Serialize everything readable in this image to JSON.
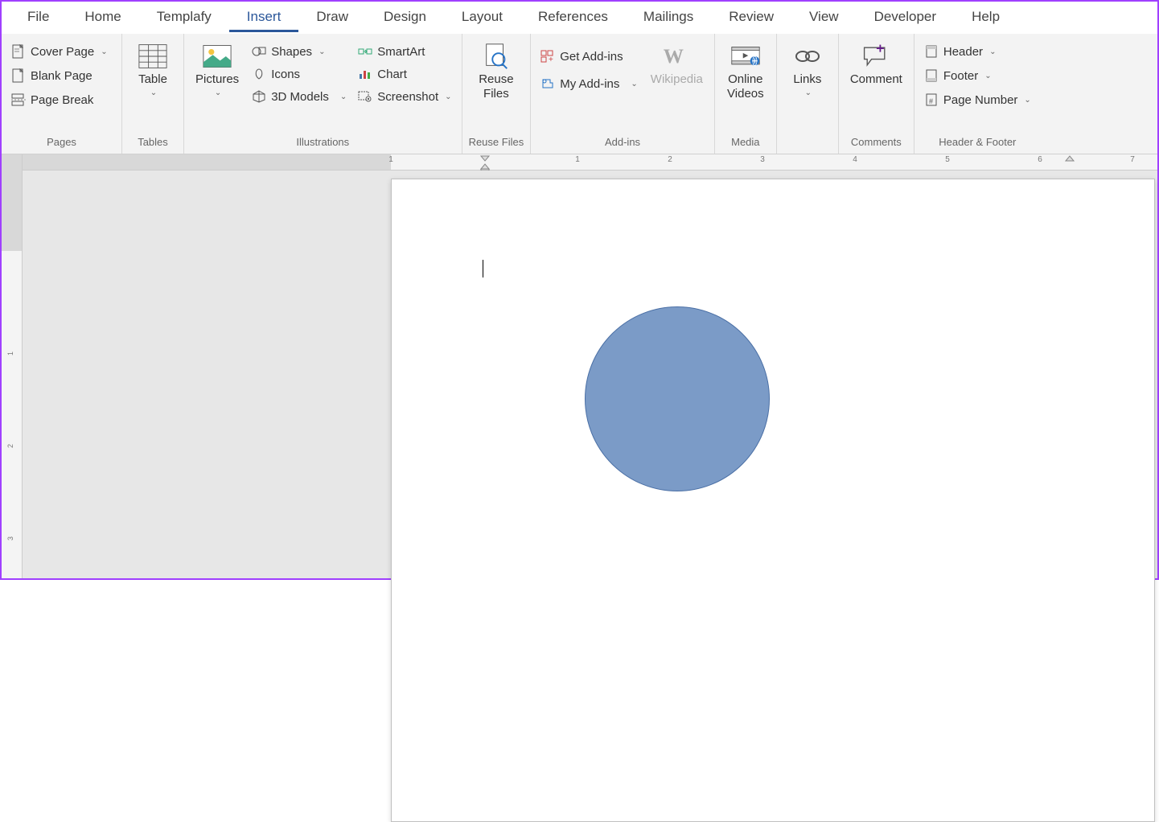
{
  "tabs": {
    "file": "File",
    "home": "Home",
    "templafy": "Templafy",
    "insert": "Insert",
    "draw": "Draw",
    "design": "Design",
    "layout": "Layout",
    "references": "References",
    "mailings": "Mailings",
    "review": "Review",
    "view": "View",
    "developer": "Developer",
    "help": "Help"
  },
  "groups": {
    "pages": {
      "label": "Pages",
      "cover_page": "Cover Page",
      "blank_page": "Blank Page",
      "page_break": "Page Break"
    },
    "tables": {
      "label": "Tables",
      "table": "Table"
    },
    "illustrations": {
      "label": "Illustrations",
      "pictures": "Pictures",
      "shapes": "Shapes",
      "icons": "Icons",
      "models": "3D Models",
      "smartart": "SmartArt",
      "chart": "Chart",
      "screenshot": "Screenshot"
    },
    "reuse": {
      "label": "Reuse Files",
      "reuse_files": "Reuse\nFiles"
    },
    "addins": {
      "label": "Add-ins",
      "get": "Get Add-ins",
      "my": "My Add-ins",
      "wikipedia": "Wikipedia"
    },
    "media": {
      "label": "Media",
      "videos": "Online\nVideos"
    },
    "links": {
      "label": "",
      "links": "Links"
    },
    "comments": {
      "label": "Comments",
      "comment": "Comment"
    },
    "header_footer": {
      "label": "Header & Footer",
      "header": "Header",
      "footer": "Footer",
      "page_number": "Page Number"
    }
  },
  "ruler": {
    "h_numbers": [
      "1",
      "1",
      "2",
      "3",
      "4",
      "5",
      "6",
      "7"
    ],
    "v_numbers": [
      "1",
      "2",
      "3"
    ]
  },
  "document": {
    "shape": "circle",
    "shape_fill": "#7b9bc7",
    "shape_border": "#4a6fa5"
  }
}
